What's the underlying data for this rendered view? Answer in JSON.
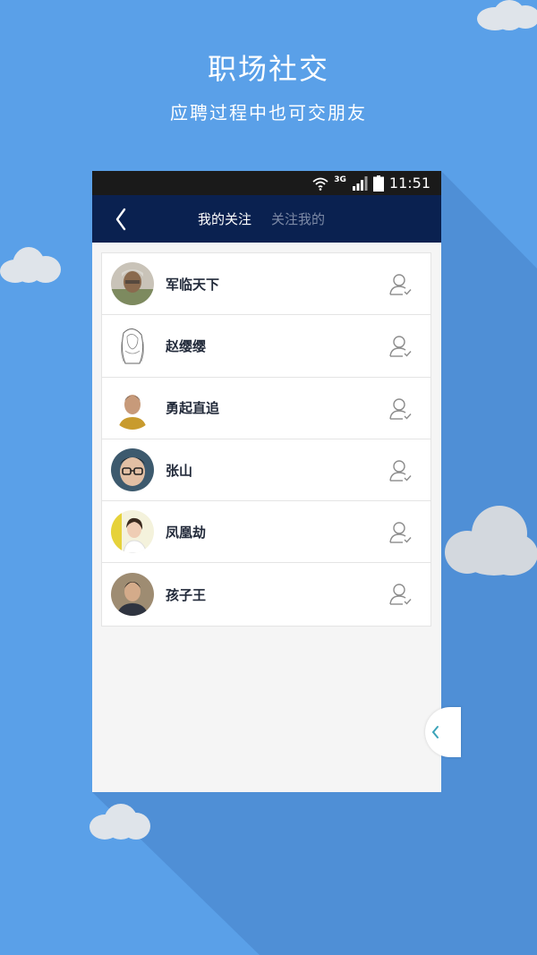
{
  "promo": {
    "title": "职场社交",
    "subtitle": "应聘过程中也可交朋友"
  },
  "status_bar": {
    "network": "3G",
    "time": "11:51",
    "icons": [
      "wifi-icon",
      "signal-icon",
      "battery-icon"
    ]
  },
  "nav": {
    "back_icon": "chevron-left-icon",
    "tabs": [
      {
        "label": "我的关注",
        "active": true
      },
      {
        "label": "关注我的",
        "active": false
      }
    ]
  },
  "contacts": [
    {
      "name": "军临天下",
      "avatar": "avatar-photo",
      "action_icon": "user-check-icon"
    },
    {
      "name": "赵缨缨",
      "avatar": "avatar-sketch",
      "action_icon": "user-check-icon"
    },
    {
      "name": "勇起直追",
      "avatar": "avatar-photo",
      "action_icon": "user-check-icon"
    },
    {
      "name": "张山",
      "avatar": "avatar-photo",
      "action_icon": "user-check-icon"
    },
    {
      "name": "凤凰劫",
      "avatar": "avatar-photo",
      "action_icon": "user-check-icon"
    },
    {
      "name": "孩子王",
      "avatar": "avatar-photo",
      "action_icon": "user-check-icon"
    }
  ],
  "side_handle_icon": "chevron-left-icon",
  "colors": {
    "background": "#5aa0e8",
    "nav_bar": "#0a2150",
    "status_bar": "#1a1a1a",
    "tab_active": "#ffffff",
    "tab_inactive": "#7d8aa6"
  }
}
